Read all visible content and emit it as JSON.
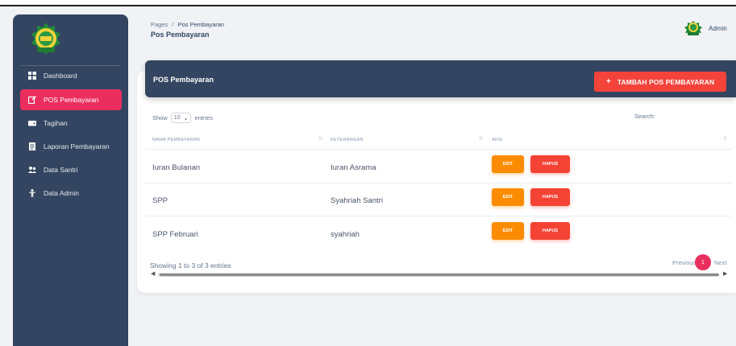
{
  "sidebar": {
    "logo_icon": "pesantren-crest-logo",
    "items": [
      {
        "label": "Dashboard",
        "icon": "dashboard-icon",
        "active": false
      },
      {
        "label": "POS Pembayaran",
        "icon": "pos-edit-icon",
        "active": true
      },
      {
        "label": "Tagihan",
        "icon": "wallet-icon",
        "active": false
      },
      {
        "label": "Laporan Pembayaran",
        "icon": "report-icon",
        "active": false
      },
      {
        "label": "Data Santri",
        "icon": "users-icon",
        "active": false
      },
      {
        "label": "Data Admin",
        "icon": "person-icon",
        "active": false
      }
    ]
  },
  "header": {
    "breadcrumb_root": "Pages",
    "breadcrumb_sep": "/",
    "breadcrumb_current": "Pos Pembayaran",
    "title": "Pos Pembayaran",
    "user_name": "Admin"
  },
  "card": {
    "title": "POS Pembayaran",
    "add_button": "TAMBAH POS PEMBAYARAN",
    "add_icon": "+",
    "show_label": "Show",
    "entries_value": "10",
    "entries_label": "entries",
    "search_label": "Search:",
    "columns": [
      "NAMA PEMBAYARAN",
      "KETERANGAN",
      "AKSI"
    ],
    "rows": [
      {
        "nama": "Iuran Bulanan",
        "keterangan": "Iuran Asrama"
      },
      {
        "nama": "SPP",
        "keterangan": "Syahriah Santri"
      },
      {
        "nama": "SPP Februari",
        "keterangan": "syahriah"
      }
    ],
    "edit_label": "EDIT",
    "hapus_label": "HAPUS",
    "info": "Showing 1 to 3 of 3 entries",
    "prev_label": "Previous",
    "page_number": "1",
    "next_label": "Next"
  },
  "colors": {
    "sidebar_bg": "#334560",
    "active": "#ea2f5f",
    "add_button": "#f4433a",
    "edit_button": "#fb8c00",
    "hapus_button": "#f44335"
  }
}
